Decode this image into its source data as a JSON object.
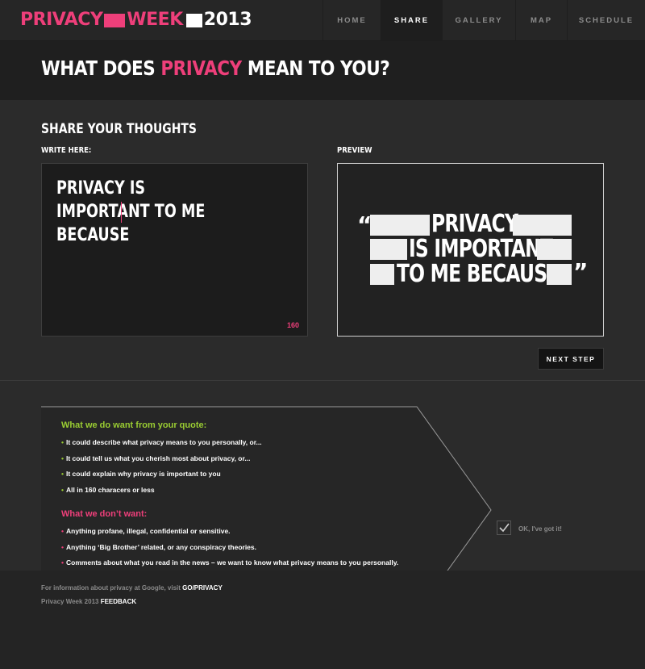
{
  "brand": {
    "word1": "PRIVACY",
    "word2": "WEEK",
    "year": "2013",
    "colors": {
      "pink": "#ee3f7a",
      "green": "#9acd32"
    }
  },
  "nav": {
    "items": [
      {
        "label": "HOME",
        "active": false
      },
      {
        "label": "SHARE",
        "active": true
      },
      {
        "label": "GALLERY",
        "active": false
      },
      {
        "label": "MAP",
        "active": false
      },
      {
        "label": "SCHEDULE",
        "active": false
      }
    ]
  },
  "header": {
    "title_prefix": "WHAT DOES ",
    "title_highlight": "PRIVACY",
    "title_suffix": " MEAN TO YOU?"
  },
  "share": {
    "heading": "SHARE YOUR THOUGHTS",
    "write_label": "WRITE HERE:",
    "preview_label": "PREVIEW",
    "input_text": "PRIVACY IS IMPORTANT TO ME\nBECAUSE",
    "char_count": "160",
    "preview": {
      "open_quote": "“",
      "close_quote": "”",
      "line1": "PRIVACY",
      "line2": "IS IMPORTANT",
      "line3": "TO ME BECAUSE"
    },
    "next_label": "NEXT STEP"
  },
  "guidelines": {
    "do_heading": "What we do want from your quote:",
    "do_items": [
      "It could describe what privacy means to you personally, or...",
      "It could tell us what you cherish most about privacy, or...",
      "It could explain why privacy is important to you",
      "All in 160 characers or less"
    ],
    "dont_heading": "What we don’t want:",
    "dont_items": [
      "Anything profane, illegal, confidential or sensitive.",
      "Anything ‘Big Brother’ related, or any conspiracy theories.",
      "Comments about what you read in the news – we want to know what privacy means to you personally."
    ],
    "ok_label": "OK, I've got it!",
    "ok_checked": true
  },
  "footer": {
    "info_text": "For information about privacy at Google, visit ",
    "info_link": "GO/PRIVACY",
    "feedback_text": "Privacy Week 2013 ",
    "feedback_link": "FEEDBACK"
  }
}
